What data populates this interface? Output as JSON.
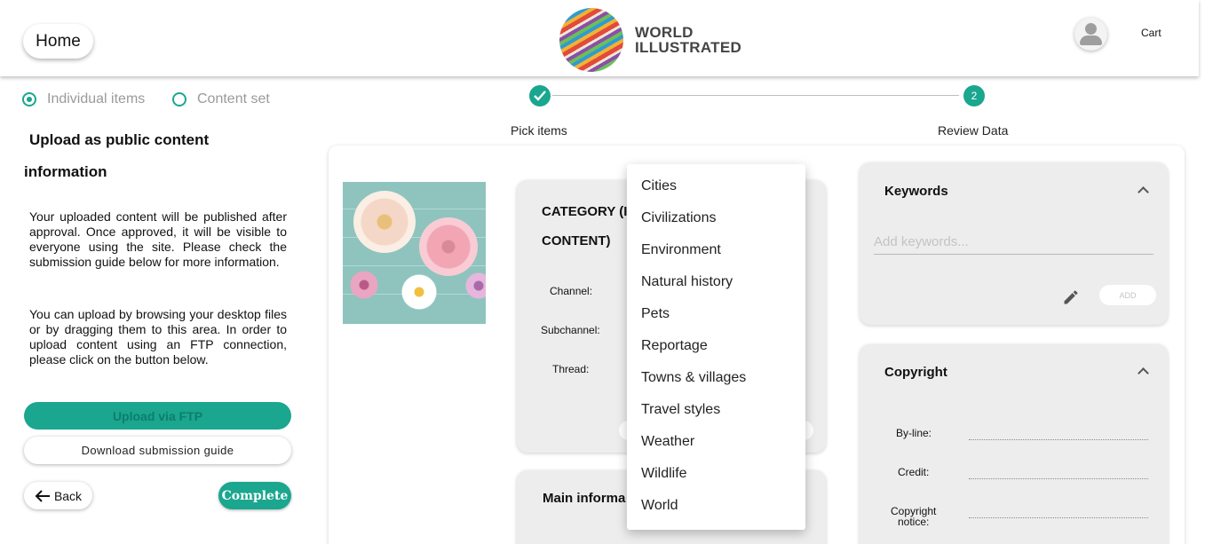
{
  "header": {
    "home_label": "Home",
    "logo_line1": "WORLD",
    "logo_line2": "ILLUSTRATED",
    "cart_label": "Cart"
  },
  "upload_mode": {
    "options": [
      "Individual items",
      "Content set"
    ],
    "selected": "Individual items"
  },
  "left_panel": {
    "title_line1": "Upload as public content",
    "title_line2": "information",
    "paragraph1": "Your uploaded content will be published after approval. Once approved, it will be visible to everyone using the site. Please check the submission guide below for more information.",
    "paragraph2": "You can upload by browsing your desktop files or by dragging them to this area. In order to upload content using an FTP connection, please click on the button below.",
    "ftp_button": "Upload via FTP",
    "guide_button": "Download submission guide",
    "back_button": "Back",
    "complete_button": "Complete"
  },
  "stepper": {
    "steps": [
      {
        "label": "Pick items",
        "state": "done"
      },
      {
        "label": "Review Data",
        "number": "2",
        "state": "active"
      }
    ],
    "accent": "#1aa68f"
  },
  "category_card": {
    "title_line1": "CATEGORY (I",
    "title_line2": "CONTENT)",
    "channel_label": "Channel:",
    "subchannel_label": "Subchannel:",
    "thread_label": "Thread:"
  },
  "main_info_card": {
    "title": "Main informa"
  },
  "keywords_card": {
    "title": "Keywords",
    "placeholder": "Add keywords...",
    "add_button": "ADD"
  },
  "copyright_card": {
    "title": "Copyright",
    "byline_label": "By-line:",
    "credit_label": "Credit:",
    "notice_label_line1": "Copyright",
    "notice_label_line2": "notice:"
  },
  "dropdown": {
    "items": [
      "Cities",
      "Civilizations",
      "Environment",
      "Natural history",
      "Pets",
      "Reportage",
      "Towns & villages",
      "Travel styles",
      "Weather",
      "Wildlife",
      "World"
    ]
  }
}
